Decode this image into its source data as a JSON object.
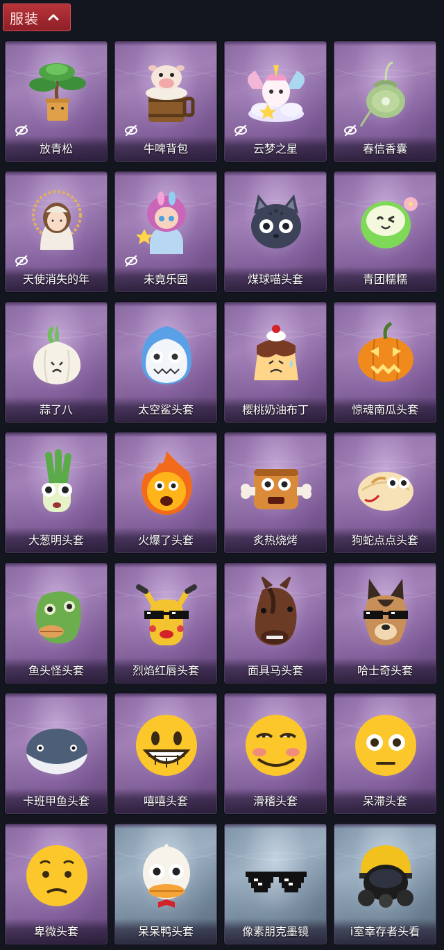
{
  "header": {
    "tab_label": "服装",
    "tab_icon": "chevron-up-icon"
  },
  "items": [
    {
      "name": "放青松",
      "hidden": true,
      "theme": "purple",
      "art": "bonsai"
    },
    {
      "name": "牛啤背包",
      "hidden": true,
      "theme": "purple",
      "art": "cow-barrel"
    },
    {
      "name": "云梦之星",
      "hidden": true,
      "theme": "purple",
      "art": "unicorn-cloud"
    },
    {
      "name": "春信香囊",
      "hidden": true,
      "theme": "purple",
      "art": "sachet"
    },
    {
      "name": "天使消失的年",
      "hidden": true,
      "theme": "purple",
      "art": "angel-doll"
    },
    {
      "name": "未竟乐园",
      "hidden": true,
      "theme": "purple",
      "art": "pink-hair-doll"
    },
    {
      "name": "煤球喵头套",
      "hidden": false,
      "theme": "purple",
      "art": "cat-head"
    },
    {
      "name": "青团糯糯",
      "hidden": false,
      "theme": "purple",
      "art": "green-dumpling"
    },
    {
      "name": "蒜了八",
      "hidden": false,
      "theme": "purple",
      "art": "garlic"
    },
    {
      "name": "太空鲨头套",
      "hidden": false,
      "theme": "purple",
      "art": "shark-head"
    },
    {
      "name": "樱桃奶油布丁",
      "hidden": false,
      "theme": "purple",
      "art": "pudding"
    },
    {
      "name": "惊魂南瓜头套",
      "hidden": false,
      "theme": "purple",
      "art": "pumpkin"
    },
    {
      "name": "大葱明头套",
      "hidden": false,
      "theme": "purple",
      "art": "scallion"
    },
    {
      "name": "火爆了头套",
      "hidden": false,
      "theme": "purple",
      "art": "fireball"
    },
    {
      "name": "炙热烧烤",
      "hidden": false,
      "theme": "purple",
      "art": "grilled-meat"
    },
    {
      "name": "狗蛇点点头套",
      "hidden": false,
      "theme": "purple",
      "art": "snake-bun"
    },
    {
      "name": "鱼头怪头套",
      "hidden": false,
      "theme": "purple",
      "art": "fish-mask"
    },
    {
      "name": "烈焰红唇头套",
      "hidden": false,
      "theme": "purple",
      "art": "yellow-mask"
    },
    {
      "name": "面具马头套",
      "hidden": false,
      "theme": "purple",
      "art": "horse-mask"
    },
    {
      "name": "哈士奇头套",
      "hidden": false,
      "theme": "purple",
      "art": "dog-mask"
    },
    {
      "name": "卡班甲鱼头套",
      "hidden": false,
      "theme": "purple",
      "art": "whale-head"
    },
    {
      "name": "嘻嘻头套",
      "hidden": false,
      "theme": "purple",
      "art": "grin-emoji"
    },
    {
      "name": "滑稽头套",
      "hidden": false,
      "theme": "purple",
      "art": "funny-emoji"
    },
    {
      "name": "呆滞头套",
      "hidden": false,
      "theme": "purple",
      "art": "stare-emoji"
    },
    {
      "name": "卑微头套",
      "hidden": false,
      "theme": "purple",
      "art": "humble-emoji"
    },
    {
      "name": "呆呆鸭头套",
      "hidden": false,
      "theme": "blue",
      "art": "duck-head"
    },
    {
      "name": "像素朋克墨镜",
      "hidden": false,
      "theme": "blue",
      "art": "pixel-sunglasses"
    },
    {
      "name": "i室幸存者头看",
      "hidden": false,
      "theme": "blue",
      "art": "gas-mask-helmet"
    }
  ]
}
